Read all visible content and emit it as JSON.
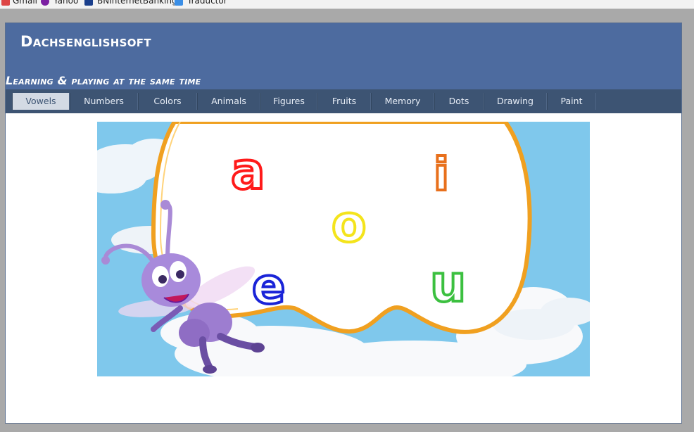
{
  "bookmarks": [
    {
      "label": "Gmail",
      "icon": "gmail-icon"
    },
    {
      "label": "Yahoo",
      "icon": "yahoo-icon"
    },
    {
      "label": "BNInternetBanking",
      "icon": "bank-icon"
    },
    {
      "label": "Traductor",
      "icon": "translate-icon"
    }
  ],
  "header": {
    "title": "Dachsenglishsoft",
    "tagline": "Learning & playing at the same time"
  },
  "nav": {
    "items": [
      {
        "label": "Vowels",
        "active": true
      },
      {
        "label": "Numbers"
      },
      {
        "label": "Colors"
      },
      {
        "label": "Animals"
      },
      {
        "label": "Figures"
      },
      {
        "label": "Fruits"
      },
      {
        "label": "Memory"
      },
      {
        "label": "Dots"
      },
      {
        "label": "Drawing"
      },
      {
        "label": "Paint"
      }
    ]
  },
  "illustration": {
    "letters": [
      {
        "char": "a",
        "color": "#ff1a1a"
      },
      {
        "char": "i",
        "color": "#e8701c"
      },
      {
        "char": "o",
        "color": "#f4e41c"
      },
      {
        "char": "e",
        "color": "#1a24d8"
      },
      {
        "char": "u",
        "color": "#3cc040"
      }
    ],
    "sky_color": "#7fc8ec",
    "frame_color": "#f0a020"
  }
}
